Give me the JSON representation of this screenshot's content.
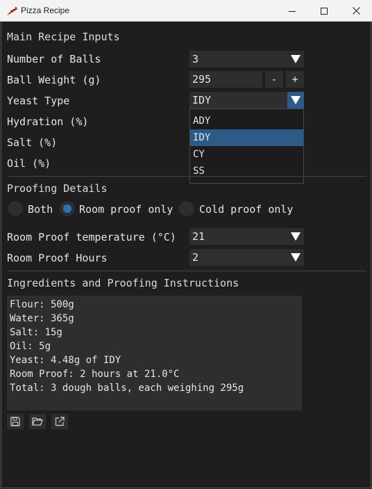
{
  "window": {
    "title": "Pizza Recipe",
    "app_icon": "pizza-icon",
    "controls": [
      "minimize-icon",
      "maximize-icon",
      "close-icon"
    ]
  },
  "main_inputs": {
    "heading": "Main Recipe Inputs",
    "number_of_balls": {
      "label": "Number of Balls",
      "value": "3"
    },
    "ball_weight": {
      "label": "Ball Weight (g)",
      "value": "295",
      "minus": "-",
      "plus": "+"
    },
    "yeast_type": {
      "label": "Yeast Type",
      "value": "IDY",
      "options": [
        "ADY",
        "IDY",
        "CY",
        "SS"
      ],
      "selected_index": 1
    },
    "hydration": {
      "label": "Hydration (%)"
    },
    "salt": {
      "label": "Salt (%)"
    },
    "oil": {
      "label": "Oil (%)"
    }
  },
  "proofing": {
    "heading": "Proofing Details",
    "options": [
      "Both",
      "Room proof only",
      "Cold proof only"
    ],
    "selected": "Room proof only",
    "room_temp": {
      "label": "Room Proof temperature (°C)",
      "value": "21"
    },
    "room_hours": {
      "label": "Room Proof Hours",
      "value": "2"
    }
  },
  "instructions": {
    "heading": "Ingredients and Proofing Instructions",
    "lines": [
      "Flour: 500g",
      "Water: 365g",
      "Salt: 15g",
      "Oil: 5g",
      "Yeast: 4.48g of IDY",
      "Room Proof: 2 hours at 21.0°C",
      "Total: 3 dough balls, each weighing 295g"
    ]
  },
  "toolbar": [
    "save-icon",
    "open-folder-icon",
    "export-icon"
  ],
  "colors": {
    "background": "#1e1e1e",
    "widget": "#2e2e31",
    "accent": "#2d5b88",
    "radio_fill": "#2b74b8",
    "text": "#e6e6e6",
    "titlebar": "#f3f3f3"
  }
}
